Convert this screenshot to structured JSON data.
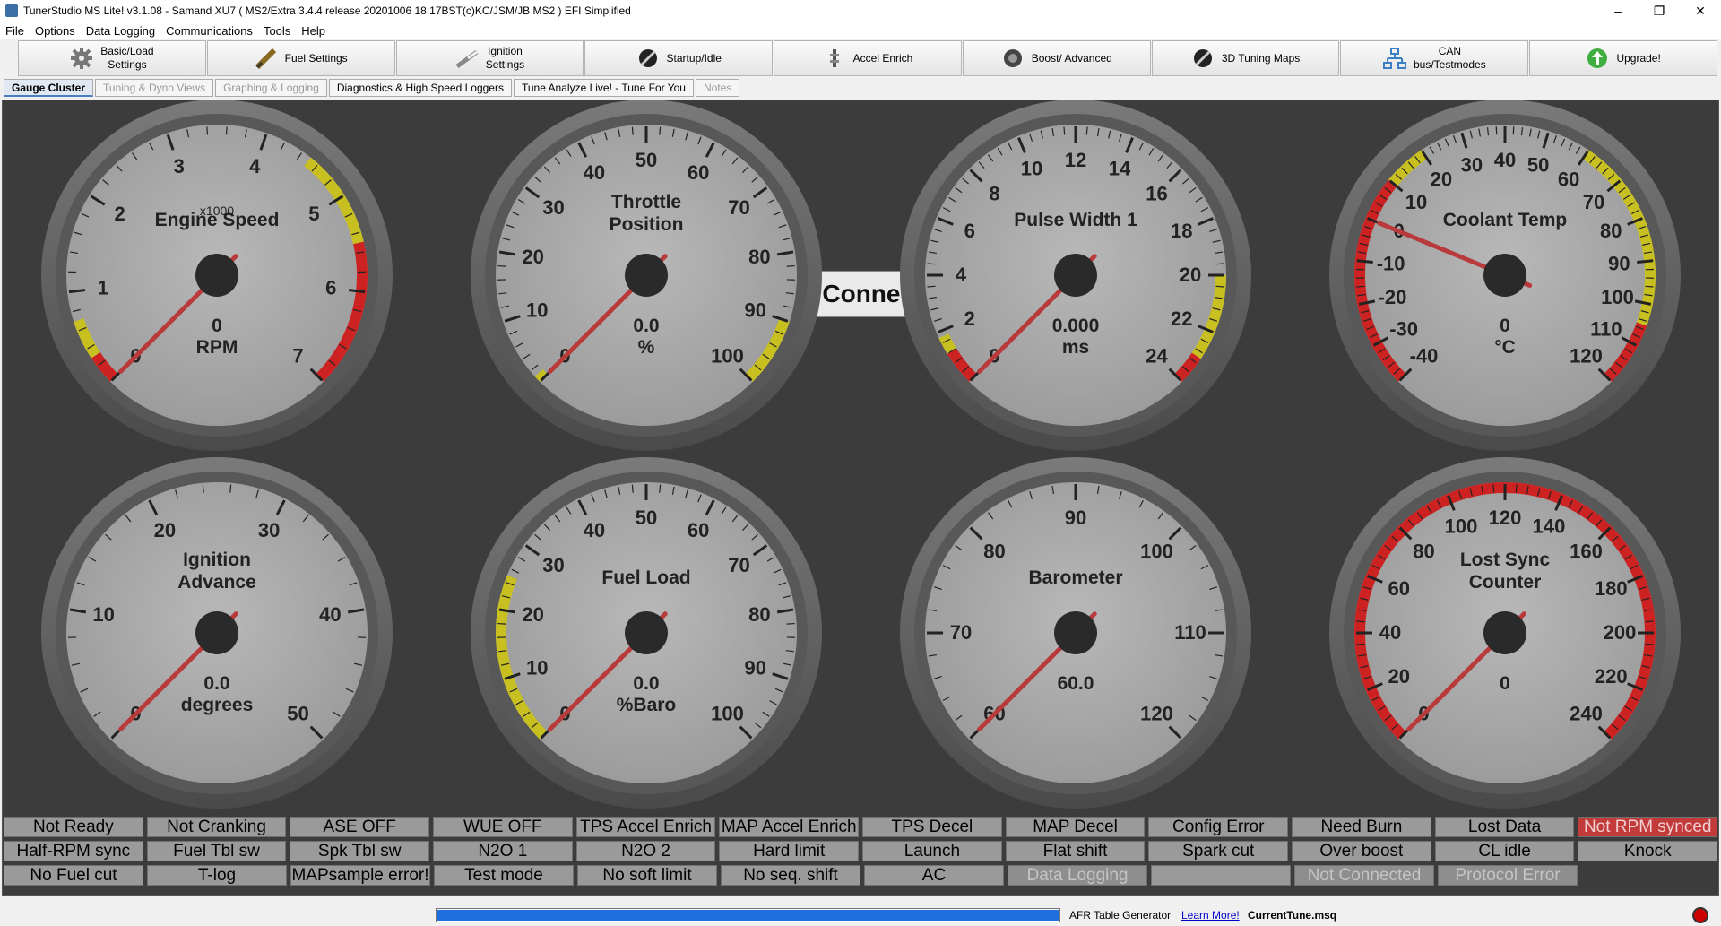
{
  "window": {
    "title": "TunerStudio MS Lite! v3.1.08 - Samand XU7 ( MS2/Extra 3.4.4 release  20201006 18:17BST(c)KC/JSM/JB   MS2 ) EFI Simplified",
    "minimize": "–",
    "maximize": "❐",
    "close": "✕"
  },
  "menu": [
    "File",
    "Options",
    "Data Logging",
    "Communications",
    "Tools",
    "Help"
  ],
  "toolbar": [
    {
      "label": "Basic/Load\nSettings",
      "icon": "gear-icon"
    },
    {
      "label": "Fuel Settings",
      "icon": "injector-icon"
    },
    {
      "label": "Ignition\nSettings",
      "icon": "spark-plug-icon"
    },
    {
      "label": "Startup/Idle",
      "icon": "wrench-icon"
    },
    {
      "label": "Accel Enrich",
      "icon": "accel-icon"
    },
    {
      "label": "Boost/ Advanced",
      "icon": "turbo-icon"
    },
    {
      "label": "3D Tuning Maps",
      "icon": "wrench-icon"
    },
    {
      "label": "CAN\nbus/Testmodes",
      "icon": "network-icon"
    },
    {
      "label": "Upgrade!",
      "icon": "upgrade-icon"
    }
  ],
  "tabs": [
    {
      "label": "Gauge Cluster",
      "state": "active"
    },
    {
      "label": "Tuning & Dyno Views",
      "state": "dim"
    },
    {
      "label": "Graphing & Logging",
      "state": "dim"
    },
    {
      "label": "Diagnostics & High Speed Loggers",
      "state": "normal"
    },
    {
      "label": "Tune Analyze Live! - Tune For You",
      "state": "normal"
    },
    {
      "label": "Notes",
      "state": "dim"
    }
  ],
  "not_connected_label": "Not Connected",
  "gauges": [
    {
      "title": [
        "Engine Speed"
      ],
      "multiplier": "x1000",
      "value": "0",
      "unit": "RPM",
      "ticks": [
        "0",
        "1",
        "2",
        "3",
        "4",
        "5",
        "6",
        "7"
      ],
      "min": 0,
      "max": 7,
      "zones": [
        {
          "from": 0,
          "to": 0.3,
          "color": "#cc2222"
        },
        {
          "from": 0.3,
          "to": 0.7,
          "color": "#c8c020"
        },
        {
          "from": 4.5,
          "to": 5.5,
          "color": "#c8c020"
        },
        {
          "from": 5.5,
          "to": 7,
          "color": "#cc2222"
        }
      ]
    },
    {
      "title": [
        "Throttle",
        "Position"
      ],
      "value": "0.0",
      "unit": "%",
      "ticks": [
        "0",
        "10",
        "20",
        "30",
        "40",
        "50",
        "60",
        "70",
        "80",
        "90",
        "100"
      ],
      "min": 0,
      "max": 100,
      "zones": [
        {
          "from": 0,
          "to": 1,
          "color": "#c8c020"
        },
        {
          "from": 90,
          "to": 100,
          "color": "#c8c020"
        }
      ]
    },
    {
      "title": [
        "Pulse Width 1"
      ],
      "value": "0.000",
      "unit": "ms",
      "ticks": [
        "0",
        "2",
        "4",
        "6",
        "8",
        "10",
        "12",
        "14",
        "16",
        "18",
        "20",
        "22",
        "24"
      ],
      "min": 0,
      "max": 24,
      "zones": [
        {
          "from": 0,
          "to": 1.2,
          "color": "#cc2222"
        },
        {
          "from": 1.2,
          "to": 1.8,
          "color": "#c8c020"
        },
        {
          "from": 20,
          "to": 23,
          "color": "#c8c020"
        },
        {
          "from": 23,
          "to": 24,
          "color": "#cc2222"
        }
      ]
    },
    {
      "title": [
        "Coolant Temp"
      ],
      "value": "0",
      "unit": "°C",
      "ticks": [
        "-40",
        "-30",
        "-20",
        "-10",
        "0",
        "10",
        "20",
        "30",
        "40",
        "50",
        "60",
        "70",
        "80",
        "90",
        "100",
        "110",
        "120"
      ],
      "min": -40,
      "max": 120,
      "zones": [
        {
          "from": -40,
          "to": 10,
          "color": "#cc2222"
        },
        {
          "from": 10,
          "to": 20,
          "color": "#c8c020"
        },
        {
          "from": 60,
          "to": 105,
          "color": "#c8c020"
        },
        {
          "from": 105,
          "to": 120,
          "color": "#cc2222"
        }
      ]
    },
    {
      "title": [
        "Ignition",
        "Advance"
      ],
      "value": "0.0",
      "unit": "degrees",
      "ticks": [
        "0",
        "10",
        "20",
        "30",
        "40",
        "50"
      ],
      "min": 0,
      "max": 50,
      "zones": []
    },
    {
      "title": [
        "Fuel Load"
      ],
      "value": "0.0",
      "unit": "%Baro",
      "ticks": [
        "0",
        "10",
        "20",
        "30",
        "40",
        "50",
        "60",
        "70",
        "80",
        "90",
        "100"
      ],
      "min": 0,
      "max": 100,
      "zones": [
        {
          "from": 0,
          "to": 25,
          "color": "#c8c020"
        }
      ]
    },
    {
      "title": [
        "Barometer"
      ],
      "value": "60.0",
      "unit": "",
      "ticks": [
        "60",
        "70",
        "80",
        "90",
        "100",
        "110",
        "120"
      ],
      "min": 60,
      "max": 120,
      "zones": []
    },
    {
      "title": [
        "Lost Sync",
        "Counter"
      ],
      "value": "0",
      "unit": "",
      "ticks": [
        "0",
        "20",
        "40",
        "60",
        "80",
        "100",
        "120",
        "140",
        "160",
        "180",
        "200",
        "220",
        "240"
      ],
      "min": 0,
      "max": 255,
      "zones": [
        {
          "from": 0,
          "to": 255,
          "color": "#cc2222"
        }
      ]
    }
  ],
  "indicators": [
    [
      {
        "t": "Not Ready",
        "s": "n"
      },
      {
        "t": "Not Cranking",
        "s": "n"
      },
      {
        "t": "ASE OFF",
        "s": "n"
      },
      {
        "t": "WUE OFF",
        "s": "n"
      },
      {
        "t": "TPS Accel Enrich",
        "s": "n"
      },
      {
        "t": "MAP Accel Enrich",
        "s": "n"
      },
      {
        "t": "TPS Decel",
        "s": "n"
      },
      {
        "t": "MAP Decel",
        "s": "n"
      },
      {
        "t": "Config Error",
        "s": "n"
      },
      {
        "t": "Need Burn",
        "s": "n"
      },
      {
        "t": "Lost Data",
        "s": "n"
      },
      {
        "t": "Not RPM synced",
        "s": "alert"
      }
    ],
    [
      {
        "t": "Half-RPM sync",
        "s": "n"
      },
      {
        "t": "Fuel Tbl sw",
        "s": "n"
      },
      {
        "t": "Spk Tbl sw",
        "s": "n"
      },
      {
        "t": "N2O 1",
        "s": "n"
      },
      {
        "t": "N2O 2",
        "s": "n"
      },
      {
        "t": "Hard limit",
        "s": "n"
      },
      {
        "t": "Launch",
        "s": "n"
      },
      {
        "t": "Flat shift",
        "s": "n"
      },
      {
        "t": "Spark cut",
        "s": "n"
      },
      {
        "t": "Over boost",
        "s": "n"
      },
      {
        "t": "CL idle",
        "s": "n"
      },
      {
        "t": "Knock",
        "s": "n"
      }
    ],
    [
      {
        "t": "No Fuel cut",
        "s": "n"
      },
      {
        "t": "T-log",
        "s": "n"
      },
      {
        "t": "MAPsample error!",
        "s": "n"
      },
      {
        "t": "Test mode",
        "s": "n"
      },
      {
        "t": "No soft limit",
        "s": "n"
      },
      {
        "t": "No seq. shift",
        "s": "n"
      },
      {
        "t": "AC",
        "s": "n"
      },
      {
        "t": "Data Logging",
        "s": "dim"
      },
      {
        "t": "",
        "s": "empty"
      },
      {
        "t": "Not Connected",
        "s": "dim"
      },
      {
        "t": "Protocol Error",
        "s": "dim"
      }
    ]
  ],
  "status": {
    "progress": 1.0,
    "afr_label": "AFR Table Generator",
    "learn_more": "Learn More!",
    "tune_file": "CurrentTune.msq"
  }
}
